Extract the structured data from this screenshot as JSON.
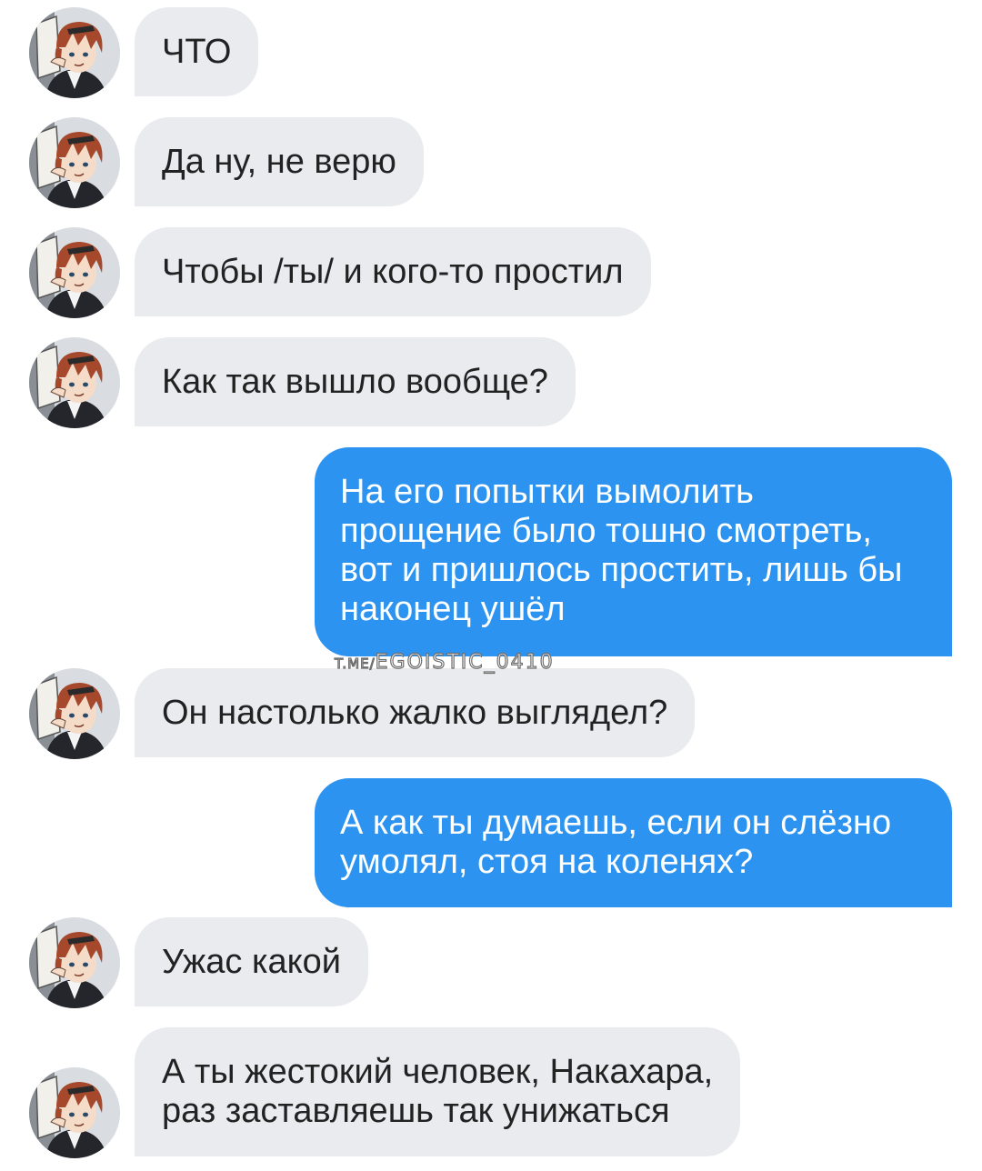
{
  "theme": {
    "incoming_bubble": "#e9ebee",
    "outgoing_bubble": "#2c93f0",
    "incoming_text": "#222222",
    "outgoing_text": "#ffffff",
    "background": "#ffffff"
  },
  "contact": {
    "avatar_icon": "anime-character-avatar",
    "name": "Накахара"
  },
  "messages": [
    {
      "side": "in",
      "text": "ЧТО"
    },
    {
      "side": "in",
      "text": "Да ну, не верю"
    },
    {
      "side": "in",
      "text": "Чтобы /ты/ и кого-то простил"
    },
    {
      "side": "in",
      "text": "Как так вышло вообще?"
    },
    {
      "side": "out",
      "lines": [
        "На его попытки вымолить",
        "прощение было тошно смотреть,",
        "вот и пришлось простить, лишь бы",
        "наконец ушёл"
      ]
    },
    {
      "side": "in",
      "text": "Он настолько жалко выглядел?"
    },
    {
      "side": "out",
      "lines": [
        "А как ты думаешь, если он слёзно",
        "умолял, стоя на коленях?"
      ]
    },
    {
      "side": "in",
      "text": "Ужас какой"
    },
    {
      "side": "in",
      "lines": [
        "А ты жестокий человек, Накахара,",
        "раз заставляешь так унижаться"
      ]
    }
  ],
  "watermark": {
    "prefix": "T.ME/",
    "handle": "EGOISTIC_0410"
  }
}
